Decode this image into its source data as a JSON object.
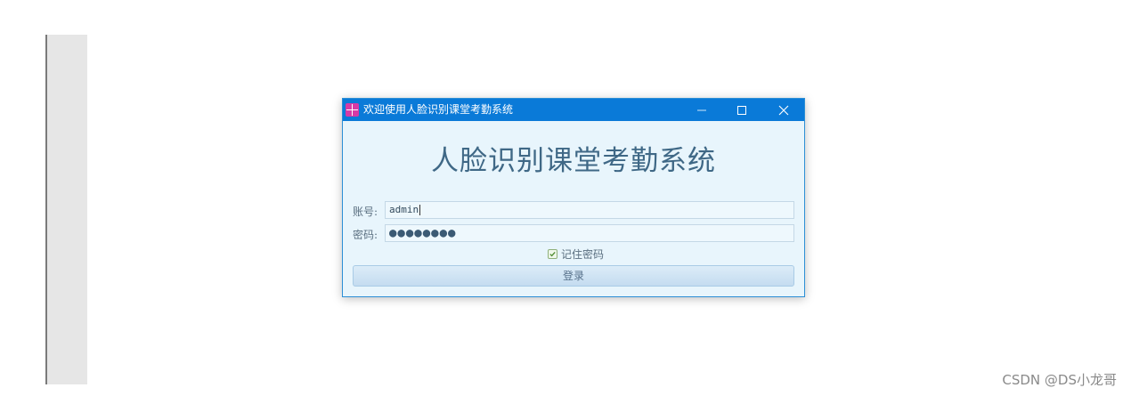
{
  "window": {
    "title": "欢迎使用人脸识别课堂考勤系统",
    "controls": {
      "minimize": "minimize-icon",
      "maximize": "maximize-icon",
      "close": "close-icon"
    }
  },
  "main": {
    "heading": "人脸识别课堂考勤系统"
  },
  "form": {
    "account_label": "账号:",
    "account_value": "admin",
    "password_label": "密码:",
    "password_masked": "●●●●●●●●",
    "remember_label": "记住密码",
    "remember_checked": true,
    "login_button": "登录"
  },
  "watermark": "CSDN @DS小龙哥",
  "colors": {
    "titlebar": "#0a7ad8",
    "window_bg": "#e8f5fc",
    "heading": "#3f6886"
  }
}
